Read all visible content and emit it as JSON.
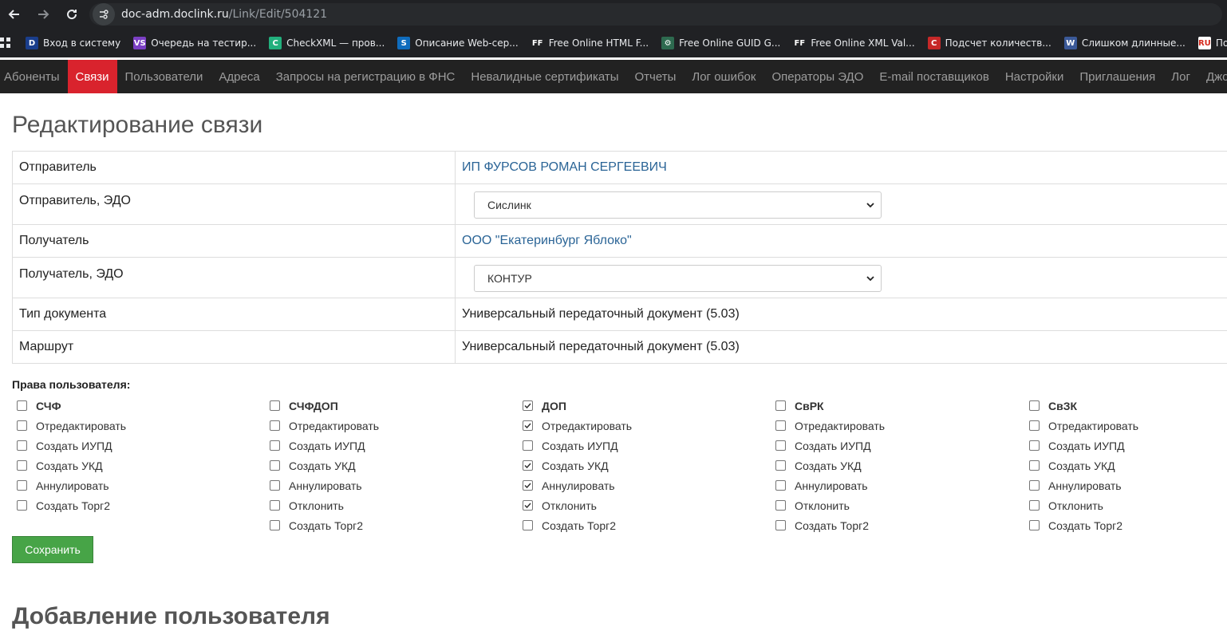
{
  "browser": {
    "url_host": "doc-adm.doclink.ru",
    "url_path": "/Link/Edit/504121",
    "bookmarks": [
      {
        "label": "Вход в систему",
        "icon": "D",
        "color": "#1a3e8c"
      },
      {
        "label": "Очередь на тестир...",
        "icon": "VS",
        "color": "#7b3fc4"
      },
      {
        "label": "CheckXML — пров...",
        "icon": "C",
        "color": "#22b07d"
      },
      {
        "label": "Описание Web-сер...",
        "icon": "S",
        "color": "#0f6cbd"
      },
      {
        "label": "Free Online HTML F...",
        "icon": "FF",
        "color": "#202124"
      },
      {
        "label": "Free Online GUID G...",
        "icon": "⚙",
        "color": "#2d6a4f"
      },
      {
        "label": "Free Online XML Val...",
        "icon": "FF",
        "color": "#202124"
      },
      {
        "label": "Подсчет количеств...",
        "icon": "C",
        "color": "#c62828"
      },
      {
        "label": "Слишком длинные...",
        "icon": "W",
        "color": "#3b5998"
      },
      {
        "label": "Подтверждение по...",
        "icon": "RU",
        "color": "#ffffff"
      }
    ]
  },
  "nav": {
    "items": [
      "Абоненты",
      "Связи",
      "Пользователи",
      "Адреса",
      "Запросы на регистрацию в ФНС",
      "Невалидные сертификаты",
      "Отчеты",
      "Лог ошибок",
      "Операторы ЭДО",
      "E-mail поставщиков",
      "Настройки",
      "Приглашения",
      "Лог",
      "Джобы"
    ],
    "active_index": 1
  },
  "page": {
    "title": "Редактирование связи",
    "section2_title": "Добавление пользователя"
  },
  "form": {
    "sender_label": "Отправитель",
    "sender_value": "ИП ФУРСОВ РОМАН СЕРГЕЕВИЧ",
    "sender_edo_label": "Отправитель, ЭДО",
    "sender_edo_value": "Сислинк",
    "receiver_label": "Получатель",
    "receiver_value": "ООО \"Екатеринбург Яблоко\"",
    "receiver_edo_label": "Получатель, ЭДО",
    "receiver_edo_value": "КОНТУР",
    "doctype_label": "Тип документа",
    "doctype_value": "Универсальный передаточный документ (5.03)",
    "route_label": "Маршрут",
    "route_value": "Универсальный передаточный документ (5.03)"
  },
  "rights": {
    "title": "Права пользователя:",
    "groups": [
      {
        "name": "СЧФ",
        "checked": false,
        "items": [
          {
            "label": "Отредактировать",
            "checked": false
          },
          {
            "label": "Создать ИУПД",
            "checked": false
          },
          {
            "label": "Создать УКД",
            "checked": false
          },
          {
            "label": "Аннулировать",
            "checked": false
          },
          {
            "label": "Создать Торг2",
            "checked": false
          }
        ]
      },
      {
        "name": "СЧФДОП",
        "checked": false,
        "items": [
          {
            "label": "Отредактировать",
            "checked": false
          },
          {
            "label": "Создать ИУПД",
            "checked": false
          },
          {
            "label": "Создать УКД",
            "checked": false
          },
          {
            "label": "Аннулировать",
            "checked": false
          },
          {
            "label": "Отклонить",
            "checked": false
          },
          {
            "label": "Создать Торг2",
            "checked": false
          }
        ]
      },
      {
        "name": "ДОП",
        "checked": true,
        "items": [
          {
            "label": "Отредактировать",
            "checked": true
          },
          {
            "label": "Создать ИУПД",
            "checked": false
          },
          {
            "label": "Создать УКД",
            "checked": true
          },
          {
            "label": "Аннулировать",
            "checked": true
          },
          {
            "label": "Отклонить",
            "checked": true
          },
          {
            "label": "Создать Торг2",
            "checked": false
          }
        ]
      },
      {
        "name": "СвРК",
        "checked": false,
        "items": [
          {
            "label": "Отредактировать",
            "checked": false
          },
          {
            "label": "Создать ИУПД",
            "checked": false
          },
          {
            "label": "Создать УКД",
            "checked": false
          },
          {
            "label": "Аннулировать",
            "checked": false
          },
          {
            "label": "Отклонить",
            "checked": false
          },
          {
            "label": "Создать Торг2",
            "checked": false
          }
        ]
      },
      {
        "name": "СвЗК",
        "checked": false,
        "items": [
          {
            "label": "Отредактировать",
            "checked": false
          },
          {
            "label": "Создать ИУПД",
            "checked": false
          },
          {
            "label": "Создать УКД",
            "checked": false
          },
          {
            "label": "Аннулировать",
            "checked": false
          },
          {
            "label": "Отклонить",
            "checked": false
          },
          {
            "label": "Создать Торг2",
            "checked": false
          }
        ]
      }
    ]
  },
  "actions": {
    "save_label": "Сохранить"
  }
}
